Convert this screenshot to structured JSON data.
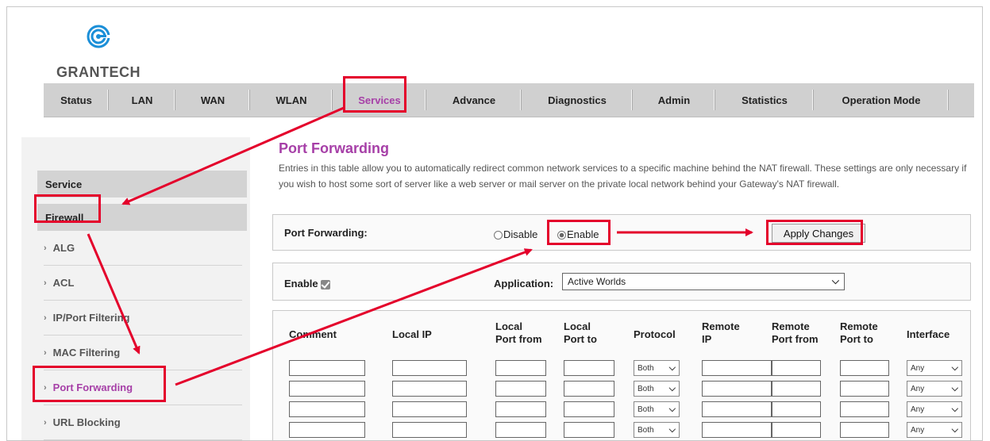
{
  "brand": {
    "name": "GRANTECH"
  },
  "nav": {
    "items": [
      {
        "label": "Status"
      },
      {
        "label": "LAN"
      },
      {
        "label": "WAN"
      },
      {
        "label": "WLAN"
      },
      {
        "label": "Services"
      },
      {
        "label": "Advance"
      },
      {
        "label": "Diagnostics"
      },
      {
        "label": "Admin"
      },
      {
        "label": "Statistics"
      },
      {
        "label": "Operation Mode"
      }
    ],
    "active": "Services"
  },
  "sidebar": {
    "sections": [
      {
        "label": "Service"
      },
      {
        "label": "Firewall"
      }
    ],
    "items": [
      {
        "label": "ALG"
      },
      {
        "label": "ACL"
      },
      {
        "label": "IP/Port Filtering"
      },
      {
        "label": "MAC Filtering"
      },
      {
        "label": "Port Forwarding"
      },
      {
        "label": "URL Blocking"
      }
    ],
    "chevron": "›",
    "active": "Port Forwarding"
  },
  "main": {
    "title": "Port Forwarding",
    "description": "Entries in this table allow you to automatically redirect common network services to a specific machine behind the NAT firewall. These settings are only necessary if you wish to host some sort of server like a web server or mail server on the private local network behind your Gateway's NAT firewall.",
    "port_forwarding": {
      "label": "Port Forwarding:",
      "options": [
        {
          "label": "Disable",
          "checked": false
        },
        {
          "label": "Enable",
          "checked": true
        }
      ],
      "apply_label": "Apply Changes"
    },
    "entry": {
      "enable_label": "Enable",
      "enable_checked": true,
      "application_label": "Application:",
      "application_value": "Active Worlds"
    },
    "table": {
      "columns": [
        "Comment",
        "Local IP",
        "Local Port from",
        "Local Port to",
        "Protocol",
        "Remote IP",
        "Remote Port from",
        "Remote Port to",
        "Interface"
      ],
      "column_lines": [
        [
          "Comment"
        ],
        [
          "Local IP"
        ],
        [
          "Local",
          "Port from"
        ],
        [
          "Local",
          "Port to"
        ],
        [
          "Protocol"
        ],
        [
          "Remote",
          "IP"
        ],
        [
          "Remote",
          "Port from"
        ],
        [
          "Remote",
          "Port to"
        ],
        [
          "Interface"
        ]
      ],
      "protocol_value": "Both",
      "interface_value": "Any",
      "row_count": 4
    }
  },
  "colors": {
    "accent": "#a63fa7",
    "highlight": "#e4002b",
    "nav_bg": "#d0d0d0",
    "brand_blue": "#1b8fd8"
  },
  "icons": {
    "dropdown": "chevron-down-icon",
    "logo": "grantech-logo-icon",
    "checkbox": "checkmark-icon"
  }
}
